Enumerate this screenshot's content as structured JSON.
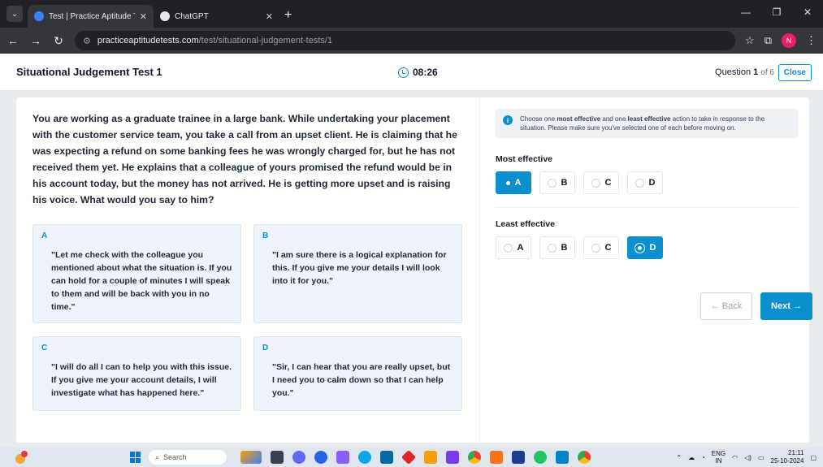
{
  "browser": {
    "tabs": [
      {
        "label": "Test | Practice Aptitude Tests",
        "active": true,
        "favicon_color": "#3b82f6"
      },
      {
        "label": "ChatGPT",
        "active": false,
        "favicon_color": "#e5e7eb"
      }
    ],
    "new_tab": "+",
    "url_domain": "practiceaptitudetests.com",
    "url_path": "/test/situational-judgement-tests/1",
    "profile_initial": "N"
  },
  "header": {
    "title": "Situational Judgement Test 1",
    "timer": "08:26",
    "question_prefix": "Question",
    "question_current": "1",
    "question_of": "of 6",
    "close_label": "Close"
  },
  "scenario": "You are working as a graduate trainee in a large bank. While undertaking your placement with the customer service team, you take a call from an upset client. He is claiming that he was expecting a refund on some banking fees he was wrongly charged for, but he has not received them yet. He explains that a colleague of yours promised the refund would be in his account today, but the money has not arrived. He is getting more upset and is raising his voice. What would you say to him?",
  "options": [
    {
      "letter": "A",
      "text": "\"Let me check with the colleague you mentioned about what the situation is. If you can hold for a couple of minutes I will speak to them and will be back with you in no time.\""
    },
    {
      "letter": "B",
      "text": "\"I am sure there is a logical explanation for this. If you give me your details I will look into it for you.\""
    },
    {
      "letter": "C",
      "text": "\"I will do all I can to help you with this issue. If you give me your account details, I will investigate what has happened here.\""
    },
    {
      "letter": "D",
      "text": "\"Sir, I can hear that you are really upset, but I need you to calm down so that I can help you.\""
    }
  ],
  "instructions": {
    "part1": "Choose one ",
    "most": "most effective",
    "part2": " and one ",
    "least": "least effective",
    "part3": " action to take in response to the situation. Please make sure you've selected one of each before moving on."
  },
  "most_effective": {
    "label": "Most effective",
    "choices": [
      "A",
      "B",
      "C",
      "D"
    ],
    "selected": "A"
  },
  "least_effective": {
    "label": "Least effective",
    "choices": [
      "A",
      "B",
      "C",
      "D"
    ],
    "selected": "D"
  },
  "nav": {
    "back_label": "← Back",
    "next_label": "Next →"
  },
  "taskbar": {
    "search_label": "Search",
    "lang_top": "ENG",
    "lang_bottom": "IN",
    "time": "21:11",
    "date": "25-10-2024"
  },
  "colors": {
    "accent": "#0b8fcf"
  }
}
